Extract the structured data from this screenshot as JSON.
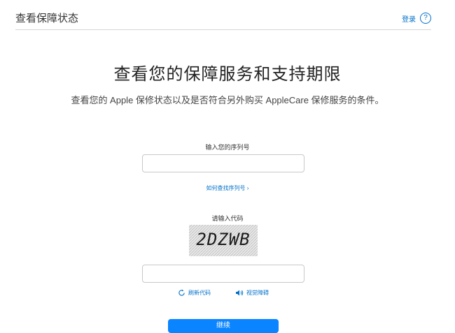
{
  "header": {
    "title": "查看保障状态",
    "signin_label": "登录",
    "help_icon": "question-circle-icon"
  },
  "main": {
    "headline": "查看您的保障服务和支持期限",
    "subheadline": "查看您的 Apple 保修状态以及是否符合另外购买 AppleCare 保修服务的条件。",
    "serial": {
      "label": "输入您的序列号",
      "value": "",
      "help_link": "如何查找序列号 ›"
    },
    "captcha": {
      "label": "请输入代码",
      "image_text": "2DZWB",
      "value": "",
      "refresh_label": "刷新代码",
      "audio_label": "视觉障碍"
    },
    "continue_label": "继续"
  },
  "colors": {
    "link": "#0070c9",
    "button": "#0a84ff",
    "border": "#c8c8c8"
  }
}
